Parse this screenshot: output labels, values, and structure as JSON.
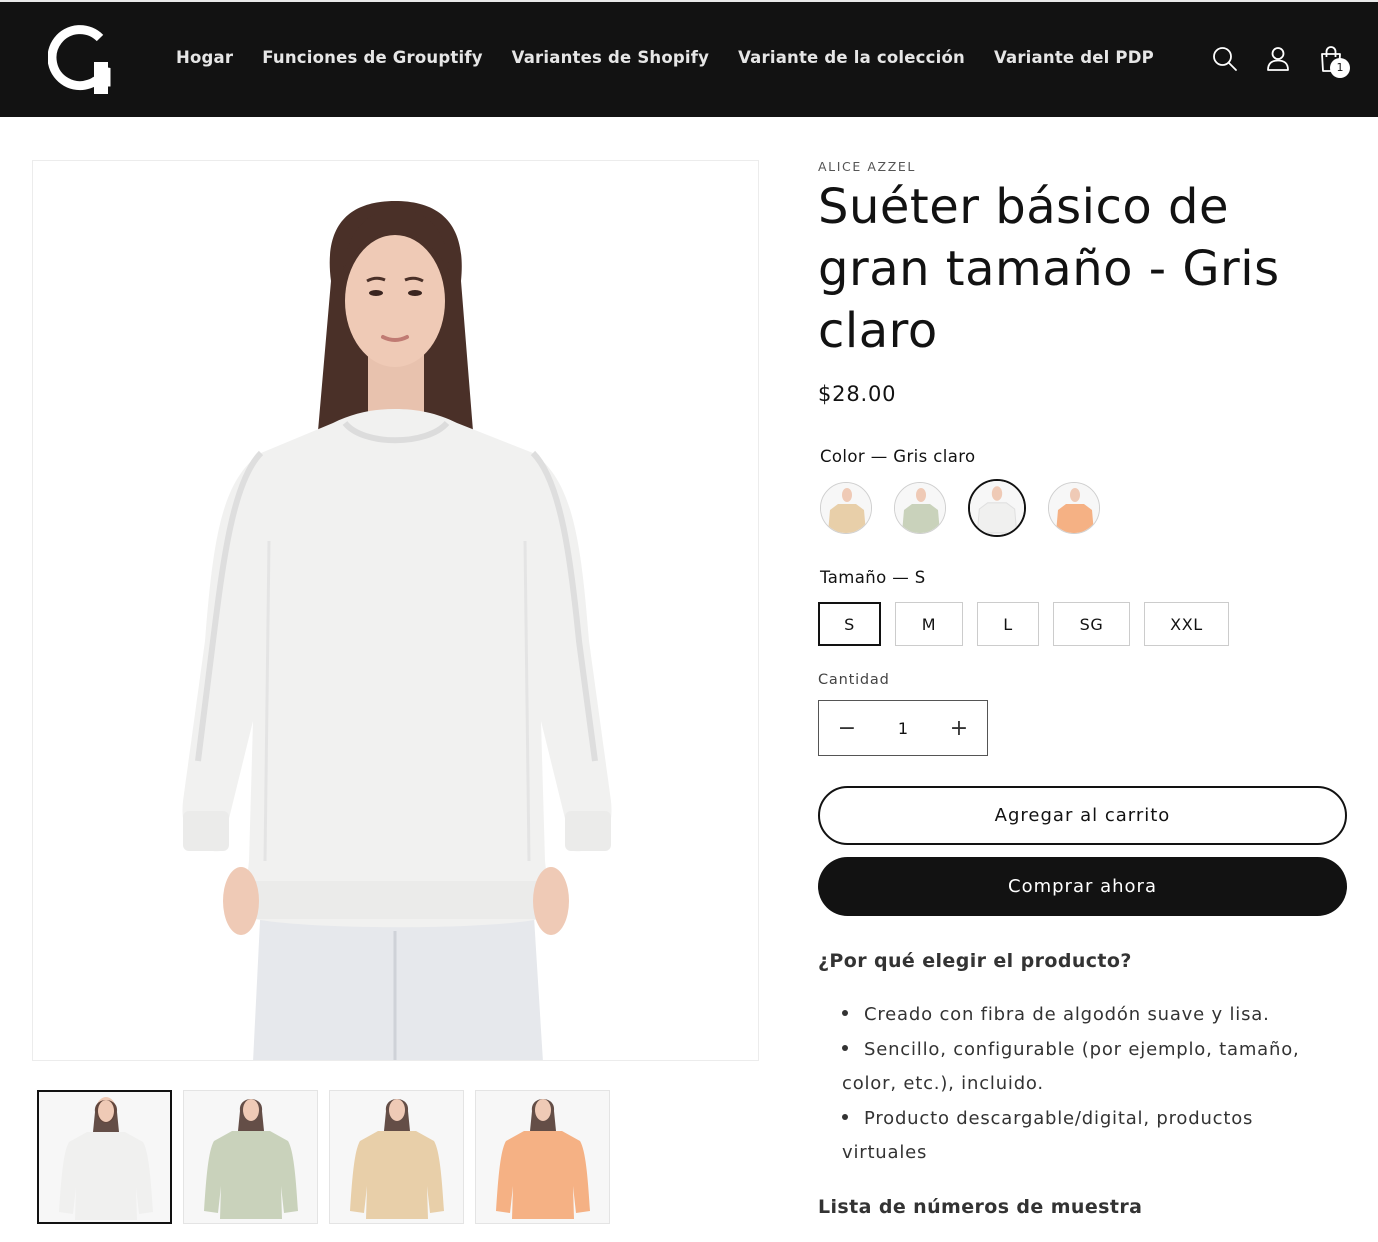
{
  "header": {
    "nav": [
      {
        "label": "Hogar"
      },
      {
        "label": "Funciones de Grouptify"
      },
      {
        "label": "Variantes de Shopify"
      },
      {
        "label": "Variante de la colección"
      },
      {
        "label": "Variante del PDP"
      }
    ],
    "cart_count": "1",
    "icons": {
      "logo": "grouptify-logo",
      "search": "search-icon",
      "account": "user-icon",
      "cart": "cart-bag-icon"
    }
  },
  "gallery": {
    "thumbnails": [
      {
        "color": "#f0f0ef"
      },
      {
        "color": "#c9d2bb"
      },
      {
        "color": "#e8cfa9"
      },
      {
        "color": "#f5b184"
      }
    ]
  },
  "product": {
    "vendor": "ALICE AZZEL",
    "title": "Suéter básico de gran tamaño - Gris claro",
    "price": "$28.00",
    "color_label": "Color — Gris claro",
    "color_swatches": [
      {
        "color": "#e8cfa9",
        "selected": false
      },
      {
        "color": "#c9d2bb",
        "selected": false
      },
      {
        "color": "#f0f0ef",
        "selected": true
      },
      {
        "color": "#f5b184",
        "selected": false
      }
    ],
    "size_label": "Tamaño — S",
    "sizes": [
      "S",
      "M",
      "L",
      "SG",
      "XXL"
    ],
    "selected_size": "S",
    "quantity_label": "Cantidad",
    "quantity": "1",
    "add_to_cart": "Agregar al carrito",
    "buy_now": "Comprar ahora",
    "why_title": "¿Por qué elegir el producto?",
    "bullets": [
      "Creado con fibra de algodón suave y lisa.",
      "Sencillo, configurable (por ejemplo, tamaño, color, etc.), incluido.",
      "Producto descargable/digital, productos virtuales"
    ],
    "list_title": "Lista de números de muestra"
  }
}
